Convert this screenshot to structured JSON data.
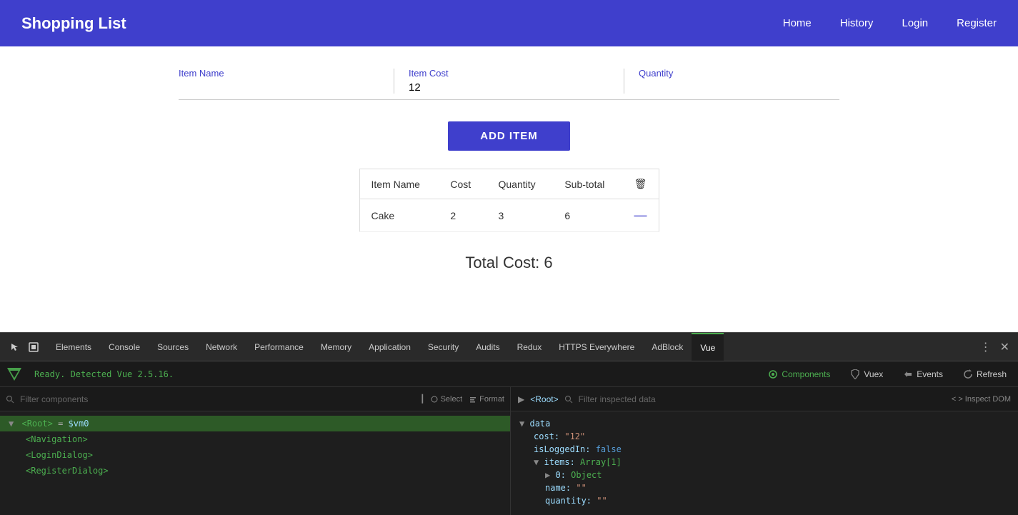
{
  "navbar": {
    "brand": "Shopping List",
    "links": [
      "Home",
      "History",
      "Login",
      "Register"
    ]
  },
  "form": {
    "item_name_label": "Item Name",
    "item_cost_label": "Item Cost",
    "item_cost_value": "12",
    "quantity_label": "Quantity",
    "add_button_label": "ADD ITEM"
  },
  "table": {
    "headers": [
      "Item Name",
      "Cost",
      "Quantity",
      "Sub-total",
      ""
    ],
    "rows": [
      {
        "name": "Cake",
        "cost": "2",
        "quantity": "3",
        "subtotal": "6"
      }
    ]
  },
  "total": {
    "label": "Total Cost: 6"
  },
  "devtools": {
    "tabs": [
      {
        "label": "Elements",
        "active": false
      },
      {
        "label": "Console",
        "active": false
      },
      {
        "label": "Sources",
        "active": false
      },
      {
        "label": "Network",
        "active": false
      },
      {
        "label": "Performance",
        "active": false
      },
      {
        "label": "Memory",
        "active": false
      },
      {
        "label": "Application",
        "active": false
      },
      {
        "label": "Security",
        "active": false
      },
      {
        "label": "Audits",
        "active": false
      },
      {
        "label": "Redux",
        "active": false
      },
      {
        "label": "HTTPS Everywhere",
        "active": false
      },
      {
        "label": "AdBlock",
        "active": false
      },
      {
        "label": "Vue",
        "active": true
      }
    ],
    "ready_text": "Ready. Detected Vue 2.5.16.",
    "toolbar_buttons": [
      "Components",
      "Vuex",
      "Events",
      "Refresh"
    ],
    "search_placeholder": "Filter components",
    "select_label": "Select",
    "format_label": "Format",
    "filter_inspected_placeholder": "Filter inspected data",
    "inspect_dom_label": "Inspect DOM",
    "tree": {
      "root": "<Root> = $vm0",
      "children": [
        "<Navigation>",
        "<LoginDialog>",
        "<RegisterDialog>"
      ]
    },
    "data_panel": {
      "section": "data",
      "items": [
        {
          "key": "cost:",
          "value": "\"12\"",
          "type": "str"
        },
        {
          "key": "isLoggedIn:",
          "value": "false",
          "type": "bool"
        },
        {
          "key": "items:",
          "value": "Array[1]",
          "type": "label"
        },
        {
          "key": "0:",
          "value": "Object",
          "type": "label"
        },
        {
          "key": "name:",
          "value": "\"\"",
          "type": "str"
        },
        {
          "key": "quantity:",
          "value": "\"\"",
          "type": "str"
        }
      ]
    }
  }
}
